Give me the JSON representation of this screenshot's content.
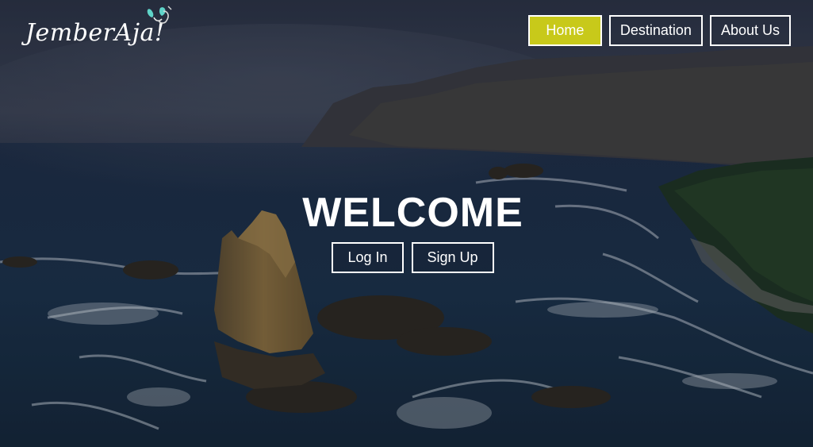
{
  "brand": {
    "logo_text": "JemberAja!",
    "logo_icon": "butterfly-icon"
  },
  "nav": {
    "items": [
      {
        "label": "Home",
        "active": true
      },
      {
        "label": "Destination",
        "active": false
      },
      {
        "label": "About Us",
        "active": false
      }
    ],
    "active_color": "#c8c91a"
  },
  "hero": {
    "heading": "WELCOME",
    "login_label": "Log In",
    "signup_label": "Sign Up",
    "background": "aerial-coastline-photo"
  }
}
